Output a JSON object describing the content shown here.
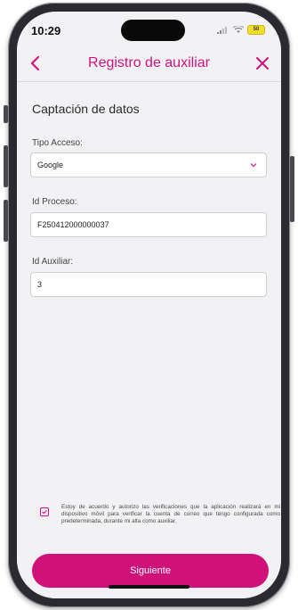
{
  "status_bar": {
    "time": "10:29",
    "battery": "50"
  },
  "nav": {
    "title": "Registro de auxiliar",
    "back_icon": "chevron-left-icon",
    "close_icon": "close-icon"
  },
  "colors": {
    "brand": "#d2107e",
    "background": "#f2f2f4"
  },
  "form": {
    "section_title": "Captación de datos",
    "tipo_acceso": {
      "label": "Tipo Acceso:",
      "value": "Google"
    },
    "id_proceso": {
      "label": "Id Proceso:",
      "value": "F250412000000037"
    },
    "id_auxiliar": {
      "label": "Id Auxiliar:",
      "value": "3"
    }
  },
  "consent": {
    "checked": true,
    "text": "Estoy de acuerdo y autorizo las verificaciones que la aplicación realizará  en mi dispositivo móvil para verificar la cuenta de correo que tengo configurada como predeterminada, durante mi alta como auxiliar."
  },
  "primary_button": {
    "label": "Siguiente"
  }
}
